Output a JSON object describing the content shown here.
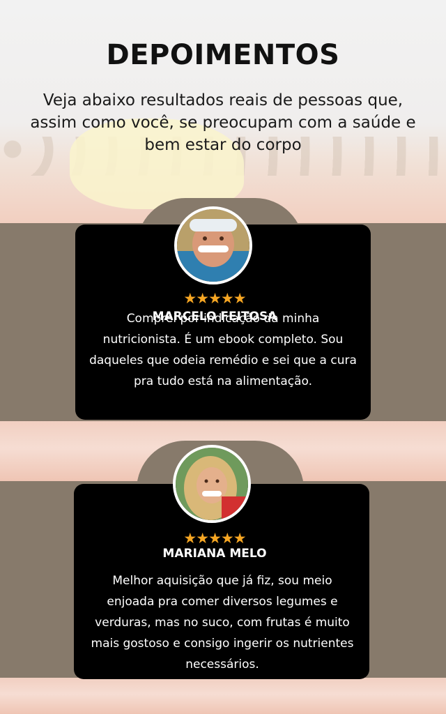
{
  "page": {
    "title": "DEPOIMENTOS",
    "subtitle": "Veja abaixo resultados reais de pessoas que, assim como você, se preocupam com a saúde e bem estar do corpo"
  },
  "colors": {
    "band": "#877a6b",
    "card": "#000000",
    "stars": "#f6a623",
    "pink": "#f1cfc1"
  },
  "testimonials": [
    {
      "name": "MARCELO FEITOSA",
      "stars": "★★★★★",
      "rating": 5,
      "text": "Comprei por indicação da minha nutricionista. É um ebook completo. Sou daqueles que odeia remédio e sei que a cura pra tudo está na alimentação."
    },
    {
      "name": "MARIANA MELO",
      "stars": "★★★★★",
      "rating": 5,
      "text": "Melhor aquisição que já fiz, sou meio enjoada pra comer diversos legumes e verduras, mas no suco, com frutas é muito mais gostoso e consigo ingerir os nutrientes necessários."
    }
  ]
}
